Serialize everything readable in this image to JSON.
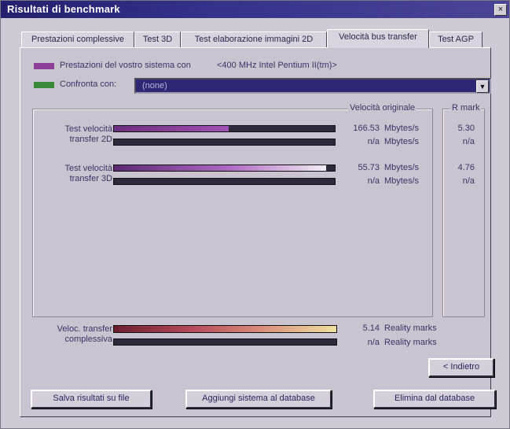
{
  "window": {
    "title": "Risultati di benchmark",
    "close": "×"
  },
  "tabs": [
    {
      "label": "Prestazioni complessive",
      "active": false
    },
    {
      "label": "Test 3D",
      "active": false
    },
    {
      "label": "Test elaborazione immagini 2D",
      "active": false
    },
    {
      "label": "Velocità bus transfer",
      "active": true
    },
    {
      "label": "Test AGP",
      "active": false
    }
  ],
  "system": {
    "label": "Prestazioni del vostro sistema con",
    "value": "<400 MHz Intel Pentium II(tm)>",
    "color": "#8d3f98"
  },
  "compare": {
    "label": "Confronta con:",
    "value": "(none)",
    "color": "#3a8a3a"
  },
  "columns": {
    "original": "Velocità originale",
    "rmark": "R mark"
  },
  "tests": [
    {
      "label_line1": "Test velocità",
      "label_line2": "transfer 2D",
      "value": "166.53",
      "unit": "Mbytes/s",
      "rmark": "5.30",
      "compare_value": "n/a",
      "compare_unit": "Mbytes/s",
      "compare_rmark": "n/a",
      "level": 0.52
    },
    {
      "label_line1": "Test velocità",
      "label_line2": "transfer 3D",
      "value": "55.73",
      "unit": "Mbytes/s",
      "rmark": "4.76",
      "compare_value": "n/a",
      "compare_unit": "Mbytes/s",
      "compare_rmark": "n/a",
      "level": 0.96
    }
  ],
  "overall": {
    "label_line1": "Veloc. transfer",
    "label_line2": "complessiva",
    "value": "5.14",
    "unit": "Reality marks",
    "compare_value": "n/a",
    "compare_unit": "Reality marks",
    "level": 1.0
  },
  "buttons": {
    "back": "< Indietro",
    "save": "Salva risultati su file",
    "add": "Aggiungi sistema al database",
    "delete": "Elimina dal database"
  }
}
